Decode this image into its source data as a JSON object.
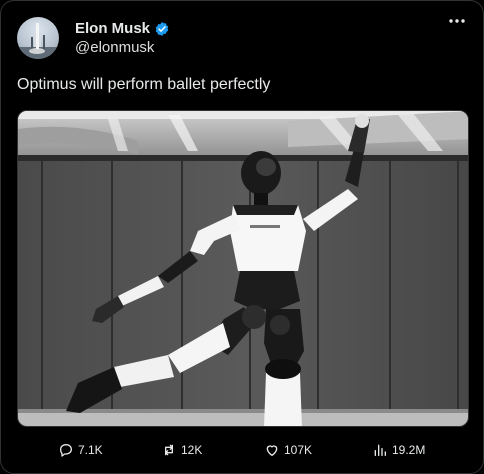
{
  "author": {
    "display_name": "Elon Musk",
    "handle": "@elonmusk",
    "verified": true,
    "verified_color": "#1d9bf0"
  },
  "tweet": {
    "text": "Optimus will perform ballet perfectly"
  },
  "media": {
    "type": "photo"
  },
  "actions": {
    "replies": "7.1K",
    "reposts": "12K",
    "likes": "107K",
    "views": "19.2M"
  },
  "colors": {
    "background": "#000000",
    "text": "#e7e9ea",
    "border": "#2f3336"
  }
}
